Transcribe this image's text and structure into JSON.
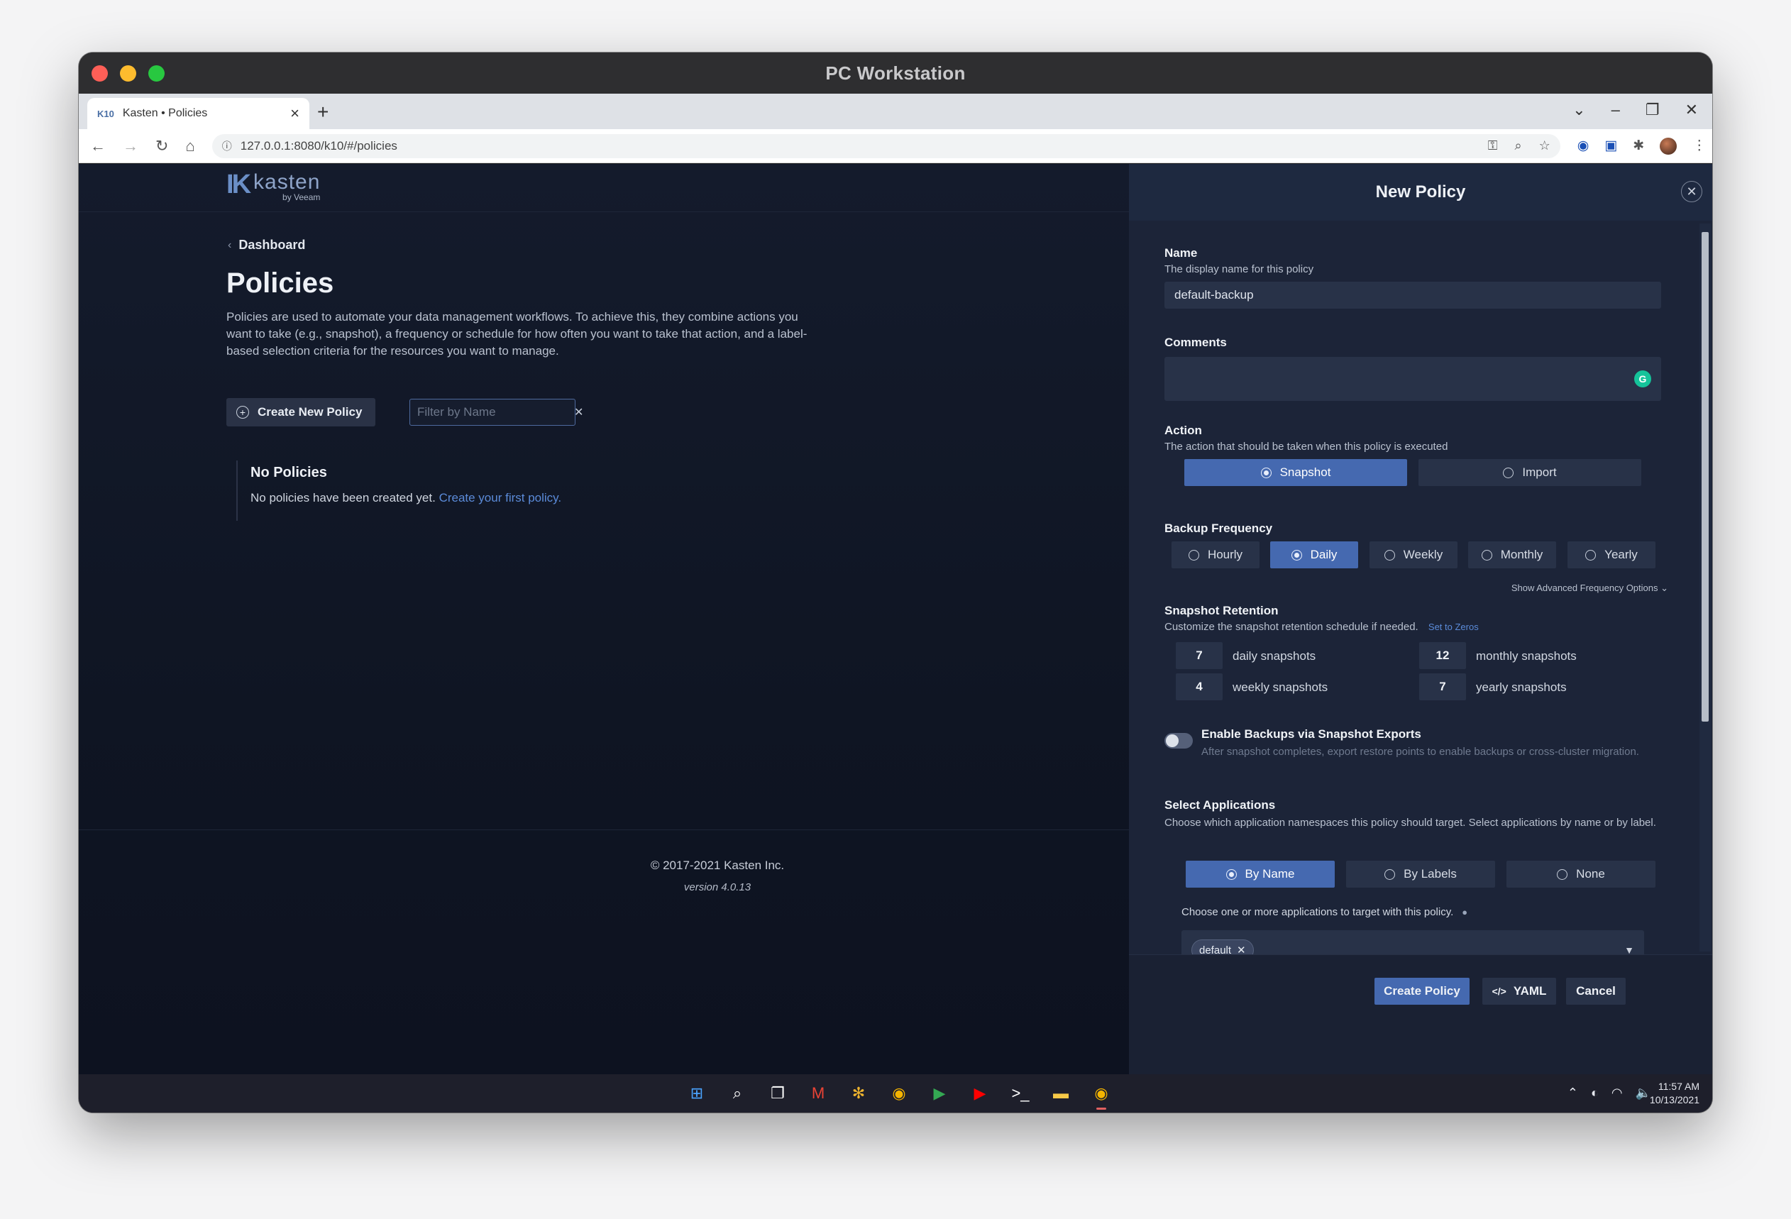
{
  "window": {
    "title": "PC Workstation"
  },
  "browser": {
    "tab_title": "Kasten • Policies",
    "tab_favicon": "K10",
    "url": "127.0.0.1:8080/k10/#/policies"
  },
  "app": {
    "logo_mark": "K",
    "logo_word": "kasten",
    "logo_sub": "by Veeam",
    "breadcrumb": "Dashboard",
    "page_title": "Policies",
    "page_description": "Policies are used to automate your data management workflows. To achieve this, they combine actions you want to take (e.g., snapshot), a frequency or schedule for how often you want to take that action, and a label-based selection criteria for the resources you want to manage.",
    "create_button": "Create New Policy",
    "filter_placeholder": "Filter by Name",
    "empty_title": "No Policies",
    "empty_text": "No policies have been created yet.",
    "empty_link": "Create your first policy.",
    "copyright": "© 2017-2021 Kasten Inc.",
    "version": "version 4.0.13"
  },
  "panel": {
    "title": "New Policy",
    "name_label": "Name",
    "name_help": "The display name for this policy",
    "name_value": "default-backup",
    "comments_label": "Comments",
    "action_label": "Action",
    "action_help": "The action that should be taken when this policy is executed",
    "actions": [
      {
        "label": "Snapshot",
        "selected": true
      },
      {
        "label": "Import",
        "selected": false
      }
    ],
    "frequency_label": "Backup Frequency",
    "frequencies": [
      {
        "label": "Hourly",
        "selected": false
      },
      {
        "label": "Daily",
        "selected": true
      },
      {
        "label": "Weekly",
        "selected": false
      },
      {
        "label": "Monthly",
        "selected": false
      },
      {
        "label": "Yearly",
        "selected": false
      }
    ],
    "advanced_link": "Show Advanced Frequency Options ⌄",
    "retention_label": "Snapshot Retention",
    "retention_help": "Customize the snapshot retention schedule if needed.",
    "retention_zero": "Set to Zeros",
    "retention": {
      "daily": {
        "value": "7",
        "label": "daily snapshots"
      },
      "weekly": {
        "value": "4",
        "label": "weekly snapshots"
      },
      "monthly": {
        "value": "12",
        "label": "monthly snapshots"
      },
      "yearly": {
        "value": "7",
        "label": "yearly snapshots"
      }
    },
    "export_title": "Enable Backups via Snapshot Exports",
    "export_help": "After snapshot completes, export restore points to enable backups or cross-cluster migration.",
    "apps_label": "Select Applications",
    "apps_help": "Choose which application namespaces this policy should target. Select applications by name or by label.",
    "app_modes": [
      {
        "label": "By Name",
        "selected": true
      },
      {
        "label": "By Labels",
        "selected": false
      },
      {
        "label": "None",
        "selected": false
      }
    ],
    "choose_text": "Choose one or more applications to target with this policy.",
    "selected_chip": "default",
    "footer": {
      "create": "Create Policy",
      "yaml": "YAML",
      "cancel": "Cancel"
    }
  },
  "taskbar": {
    "time": "11:57 AM",
    "date": "10/13/2021"
  }
}
